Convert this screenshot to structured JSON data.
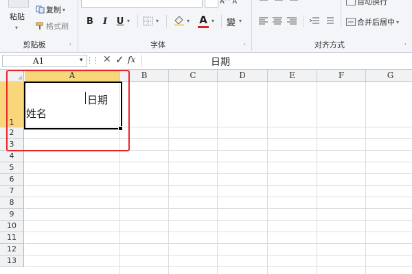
{
  "ribbon": {
    "clipboard": {
      "paste_label": "粘贴",
      "copy_label": "复制",
      "format_painter_label": "格式刷",
      "group_label": "剪贴板"
    },
    "font": {
      "group_label": "字体",
      "bold": "B",
      "italic": "I",
      "underline": "U",
      "font_color_letter": "A",
      "wen_glyph": "變",
      "font_color": "#e02020"
    },
    "alignment": {
      "group_label": "对齐方式",
      "merge_label": "合并后居中",
      "wrap_label": "自动换行"
    }
  },
  "formula_bar": {
    "name_box": "A1",
    "fx_label": "fx",
    "content": "日期"
  },
  "sheet": {
    "columns": [
      "A",
      "B",
      "C",
      "D",
      "E",
      "F",
      "G"
    ],
    "rows": [
      "1",
      "2",
      "3",
      "4",
      "5",
      "6",
      "7",
      "8",
      "9",
      "10",
      "11",
      "12",
      "13"
    ],
    "cell_a1_top": "日期",
    "cell_a1_bottom": "姓名"
  },
  "colors": {
    "highlight_box": "#e5262b",
    "selected_header": "#f9d67a"
  }
}
